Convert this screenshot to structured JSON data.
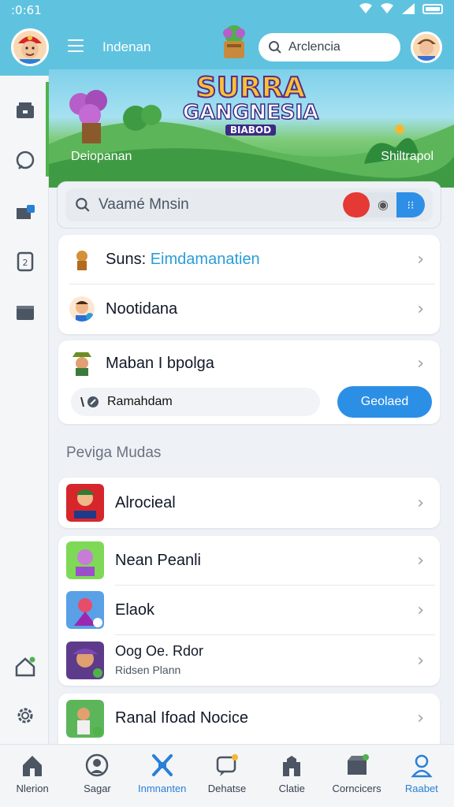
{
  "status_bar": {
    "time": ":0:61"
  },
  "header": {
    "title": "Indenan",
    "search_placeholder": "Arclencia"
  },
  "hero": {
    "title_line1": "SURRA",
    "title_line2": "GANGNESIA",
    "title_line3": "BIABOD",
    "left_caption": "Deiopanan",
    "right_caption": "Shiltrapol"
  },
  "search": {
    "placeholder": "Vaamé Mnsin"
  },
  "list_group_1": [
    {
      "prefix": "Suns:",
      "label": "Eimdamanatien",
      "icon": "character-icon"
    },
    {
      "label": "Nootidana",
      "icon": "player-avatar-icon"
    }
  ],
  "feature_card": {
    "label": "Maban I bpolga",
    "pill_text": "Ramahdam",
    "button_label": "Geolaed"
  },
  "section_title": "Peviga Mudas",
  "games": [
    {
      "label": "Alrocieal",
      "icon": "game-thumbnail-icon"
    },
    {
      "label": "Nean Peanli",
      "icon": "game-thumbnail-icon"
    },
    {
      "label": "Elaok",
      "icon": "game-thumbnail-icon"
    },
    {
      "label": "Oog Oe. Rdor",
      "sub": "Ridsen Plann",
      "icon": "game-thumbnail-icon"
    },
    {
      "label": "Ranal Ifoad Nocice",
      "icon": "game-thumbnail-icon"
    }
  ],
  "bottom_nav": [
    {
      "label": "Nlerion",
      "icon": "home-icon"
    },
    {
      "label": "Sagar",
      "icon": "avatar-icon"
    },
    {
      "label": "Inmnanten",
      "icon": "cross-swords-icon",
      "active": true
    },
    {
      "label": "Dehatse",
      "icon": "chat-bubble-icon"
    },
    {
      "label": "Clatie",
      "icon": "castle-icon"
    },
    {
      "label": "Corncicers",
      "icon": "chest-icon"
    },
    {
      "label": "Raabet",
      "icon": "profile-icon"
    }
  ],
  "colors": {
    "header_bg": "#5fc3df",
    "accent_blue": "#2c8fe6",
    "link_teal": "#2a9dd6",
    "rail_accent": "#4fb34a"
  }
}
